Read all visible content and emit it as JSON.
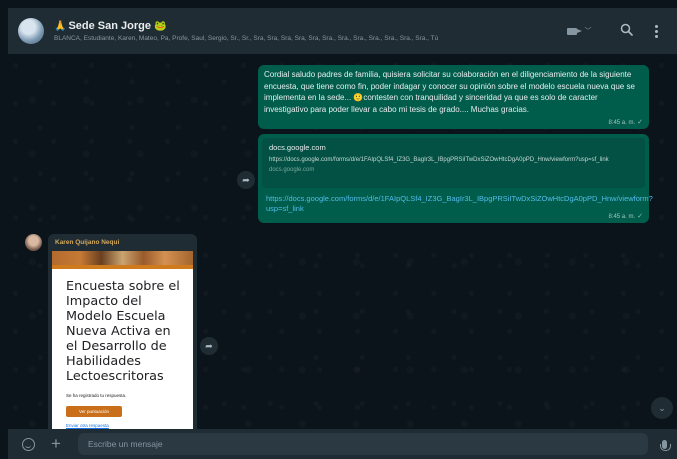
{
  "header": {
    "lead_emoji": "🙏",
    "group_name": "Sede San Jorge",
    "tail_emoji": "🐸",
    "participants": "BLANCA, Estudiante, Karen, Mateo, Pa, Profe, Saul, Sergio, Sr., Sr., Sra, Sra, Sra, Sra, Sra, Sra., Sra., Sra., Sra., Sra., Sra., Sra., Tú",
    "video_call_icon": "video-camera-icon",
    "search_icon": "🔍",
    "menu_icon": "three-dots-icon"
  },
  "messages": {
    "first": {
      "text": "Cordial saludo padres de familia, quisiera solicitar su colaboración en el diligenciamiento de la siguiente encuesta, que tiene como fin, poder indagar y conocer su opinión sobre el modelo escuela nueva que se implementa en la sede... 🙂contesten con tranquilidad y sinceridad ya que es solo de caracter investigativo para poder llevar a cabo mi tesis de grado.... Muchas gracias.",
      "time": "8:45 a. m.",
      "tick": "✓"
    },
    "second": {
      "link_title": "docs.google.com",
      "link_desc": "https://docs.google.com/forms/d/e/1FAIpQLSf4_IZ3G_BagIr3L_IBpgPRSiITwDxSiZOwHtcDgA0pPD_Hnw/viewform?usp=sf_link",
      "link_domain": "docs.google.com",
      "url": "https://docs.google.com/forms/d/e/1FAIpQLSf4_IZ3G_BagIr3L_IBpgPRSiITwDxSiZOwHtcDgA0pPD_Hnw/viewform?usp=sf_link",
      "time": "8:45 a. m.",
      "tick": "✓"
    },
    "third": {
      "sender": "Karen Quijano Nequi",
      "form_title": "Encuesta sobre el Impacto del Modelo Escuela Nueva Activa en el Desarrollo de Habilidades Lectoescritoras",
      "form_note": "Se ha registrado tu respuesta.",
      "form_button": "Ver puntuación",
      "form_link": "Enviar otra respuesta"
    }
  },
  "controls": {
    "forward_icon": "➦",
    "scroll_down_icon": "⌄"
  },
  "footer": {
    "attach_icon": "+",
    "placeholder": "Escribe un mensaje"
  },
  "colors": {
    "header_bg": "#202c33",
    "chat_bg": "#0b141a",
    "outgoing_bubble": "#005c4b",
    "incoming_bubble": "#202c33",
    "link_color": "#53bdeb",
    "form_accent": "#c96f1a"
  }
}
